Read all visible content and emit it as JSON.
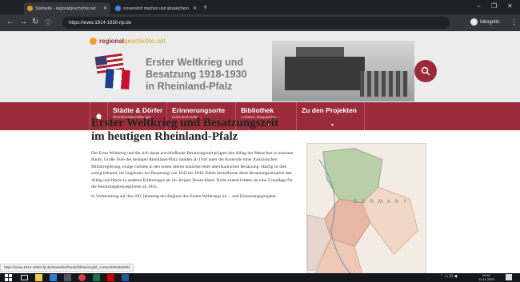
{
  "browser": {
    "tabs": [
      {
        "title": "Startseite - regionalgeschichte.net",
        "active": true,
        "favicon_color": "#e39a1f"
      },
      {
        "title": "screenshot machen und abspeichern",
        "active": false,
        "favicon_color": "#4285f4"
      }
    ],
    "url": "https://www.1914-1930-rlp.de",
    "profile_name": "Inkognito",
    "status_url": "https://www.1914-1930-rlp.de/startseite/feeds/fsfsite/ecg/kf_content/301920/8/x"
  },
  "site": {
    "logo_regional": "regional",
    "logo_rest": "geschichte.net",
    "hero_title_lines": [
      "Erster Weltkrieg und",
      "Besatzung 1918-1930",
      "in Rheinland-Pfalz"
    ],
    "nav": [
      {
        "label": "Städte & Dörfer",
        "sub": "Überblicksdarstellungen",
        "caret": false
      },
      {
        "label": "Erinnerungsorte",
        "sub": "Kulturdenkmäler ...",
        "caret": false
      },
      {
        "label": "Bibliothek",
        "sub": "Aufsätze, Biographien ...",
        "caret": true
      },
      {
        "label": "Zu den Projekten",
        "sub": "",
        "caret": true
      }
    ],
    "article_title_lines": [
      "Erster Weltkrieg und Besatzungszeit",
      "im heutigen Rheinland-Pfalz"
    ],
    "article_paragraphs": [
      "Der Erste Weltkrieg und die sich daran anschließende Besatzungszeit prägten den Alltag der Menschen in unserem Raum. Große Teile des heutigen Rheinland-Pfalz standen ab 1918 unter der Kontrolle einer französischen Militärregierung, einige Gebiete in den ersten Jahren zunächst einer amerikanischen Besatzung. Häufig ist dies wenig bekannt, im Gegensatz zur Besatzung von 1945 bis 1949. Dabei beeinflusste diese Besatzungssituation den Alltag und führte zu anderen Erfahrungen als im übrigen Deutschland. Nicht zuletzt bildete sie eine Grundlage für die Besatzungskonzeptionen ab 1945.",
      "In Vorbereitung auf den 100. Jahrestag des Beginns des Ersten Weltkriegs im ... und Erinnerungsprojekte"
    ],
    "map_label": "GERMANY",
    "colors": {
      "brand": "#9a2b3a",
      "accent": "#e39a1f"
    }
  },
  "taskbar": {
    "time": "09:40",
    "date": "13.11.2020"
  }
}
